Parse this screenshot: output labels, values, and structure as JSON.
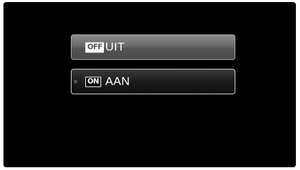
{
  "menu": {
    "options": [
      {
        "badge": "OFF",
        "label": "UIT",
        "selected": false
      },
      {
        "badge": "ON",
        "label": "AAN",
        "selected": true
      }
    ]
  },
  "colors": {
    "screen_background": "#000000",
    "unselected_button": "#6a6a6a",
    "selected_button": "#1c1c1c",
    "text": "#ffffff"
  },
  "icons": {
    "off_badge": "off-badge-icon",
    "on_badge": "on-badge-icon",
    "selection_cursor": "selection-cursor-icon"
  }
}
